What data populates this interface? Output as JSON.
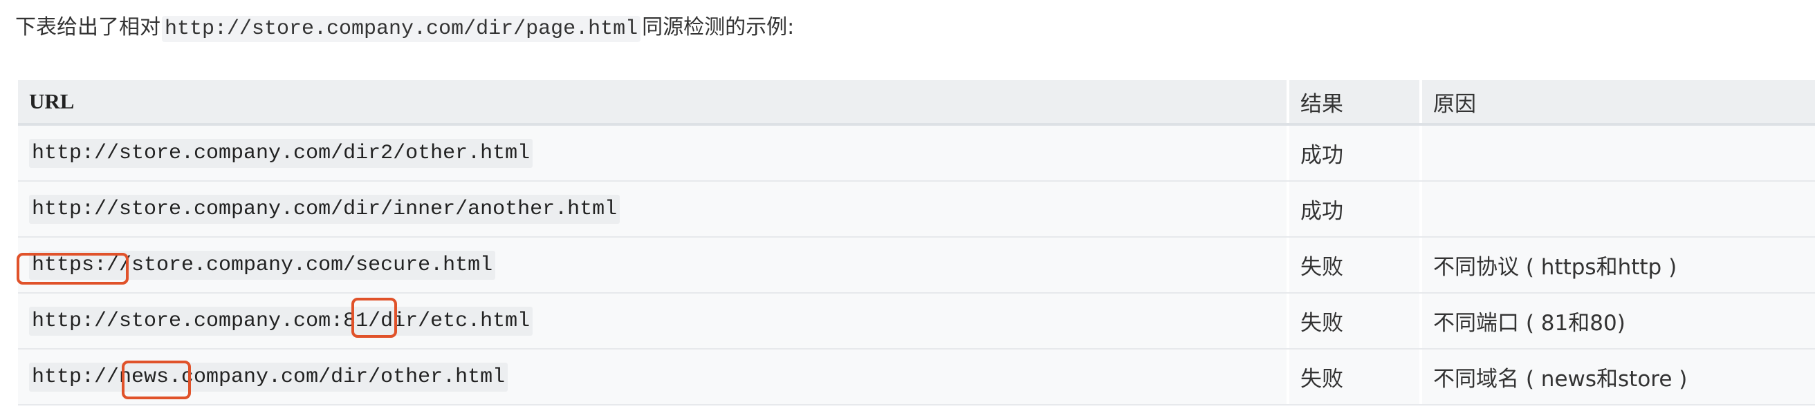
{
  "intro": {
    "prefix": "下表给出了相对",
    "code": "http://store.company.com/dir/page.html",
    "suffix": "同源检测的示例:"
  },
  "table": {
    "headers": {
      "url": "URL",
      "result": "结果",
      "reason": "原因"
    },
    "rows": [
      {
        "url": "http://store.company.com/dir2/other.html",
        "result": "成功",
        "reason": ""
      },
      {
        "url": "http://store.company.com/dir/inner/another.html",
        "result": "成功",
        "reason": ""
      },
      {
        "url": "https://store.company.com/secure.html",
        "result": "失败",
        "reason": "不同协议 ( https和http )"
      },
      {
        "url": "http://store.company.com:81/dir/etc.html",
        "result": "失败",
        "reason": "不同端口 ( 81和80)"
      },
      {
        "url": "http://news.company.com/dir/other.html",
        "result": "失败",
        "reason": "不同域名 ( news和store )"
      }
    ]
  },
  "highlights": [
    {
      "row": 2,
      "text": "https:/"
    },
    {
      "row": 3,
      "text": "81"
    },
    {
      "row": 4,
      "text": "news."
    }
  ],
  "colors": {
    "highlight": "#e0522a",
    "header_bg": "#edeff1",
    "row_bg": "#f8f9fa"
  }
}
